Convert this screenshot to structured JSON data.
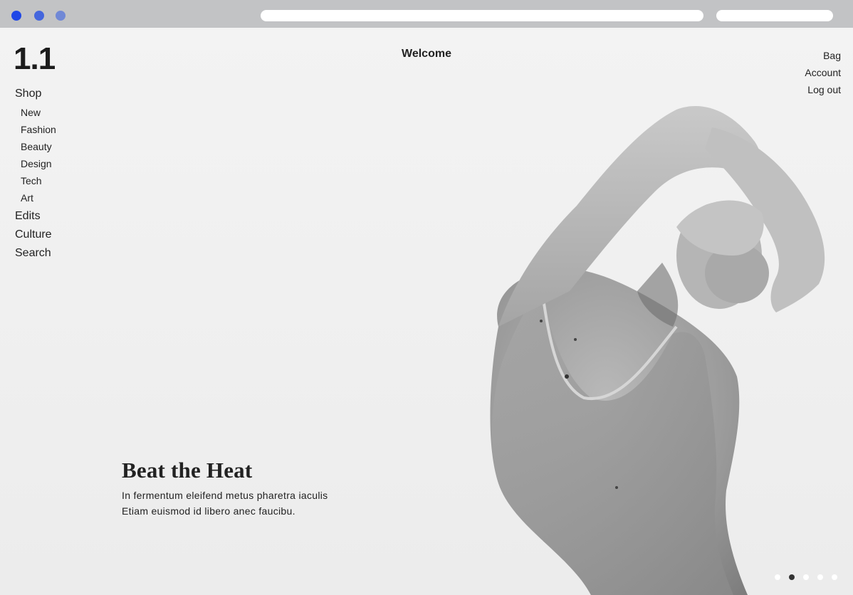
{
  "logo": "1.1",
  "header": {
    "welcome": "Welcome"
  },
  "nav": {
    "shop": "Shop",
    "shop_items": [
      "New",
      "Fashion",
      "Beauty",
      "Design",
      "Tech",
      "Art"
    ],
    "edits": "Edits",
    "culture": "Culture",
    "search": "Search"
  },
  "account": {
    "bag": "Bag",
    "account": "Account",
    "logout": "Log out"
  },
  "hero": {
    "title": "Beat the Heat",
    "line1": "In fermentum eleifend metus pharetra iaculis",
    "line2": "Etiam euismod id libero anec faucibu."
  },
  "carousel": {
    "total": 5,
    "active_index": 1
  },
  "colors": {
    "window_dot_1": "#1f47e6",
    "window_dot_2": "#4466dd",
    "window_dot_3": "#7088d6",
    "chrome": "#c2c3c5",
    "text": "#222222"
  }
}
